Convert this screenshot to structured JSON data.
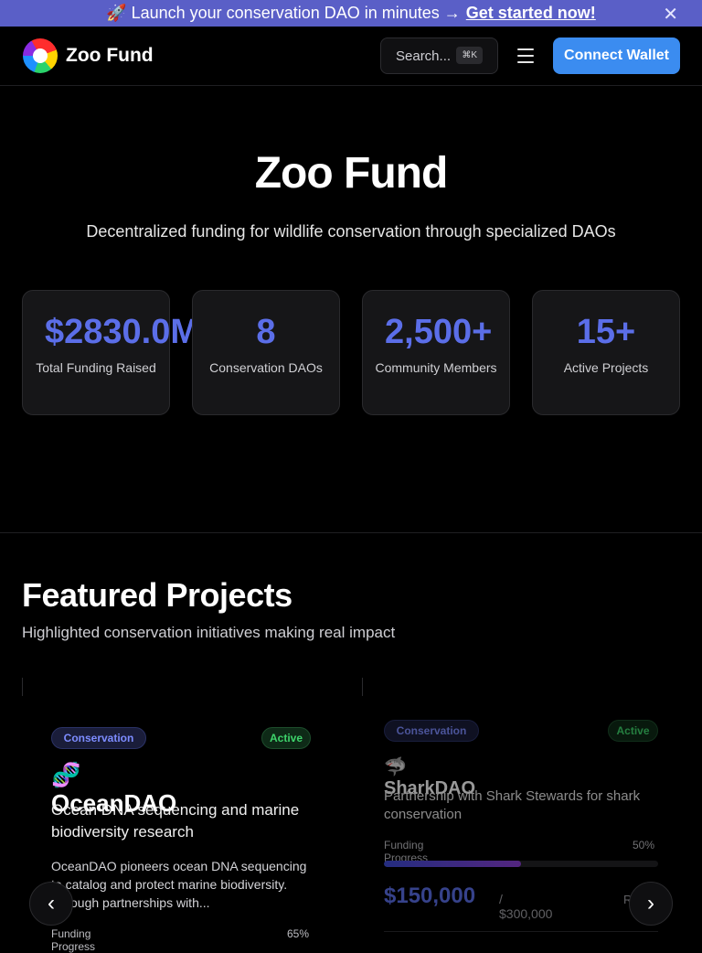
{
  "banner": {
    "text": "🚀 Launch your conservation DAO in minutes →",
    "link": "Get started now!",
    "close": "✕"
  },
  "nav": {
    "brand": "Zoo Fund",
    "search_placeholder": "Search...",
    "search_shortcut": "⌘K",
    "connect": "Connect Wallet"
  },
  "hero": {
    "title": "Zoo Fund",
    "subtitle": "Decentralized funding for wildlife conservation through specialized DAOs"
  },
  "stats": [
    {
      "value": "$2830.0M+",
      "label": "Total Funding Raised"
    },
    {
      "value": "8",
      "label": "Conservation DAOs"
    },
    {
      "value": "2,500+",
      "label": "Community Members"
    },
    {
      "value": "15+",
      "label": "Active Projects"
    }
  ],
  "featured": {
    "title": "Featured Projects",
    "subtitle": "Highlighted conservation initiatives making real impact",
    "projects": [
      {
        "category": "Conservation",
        "status": "Active",
        "icon": "🧬",
        "name": "OceanDAO",
        "tagline": "Ocean DNA sequencing and marine biodiversity research",
        "description": "OceanDAO pioneers ocean DNA sequencing to catalog and protect marine biodiversity. Through partnerships with...",
        "funding_label": "Funding Progress",
        "funding_pct": "65%"
      },
      {
        "category": "Conservation",
        "status": "Active",
        "icon": "🦈",
        "name": "SharkDAO",
        "tagline": "Partnership with Shark Stewards for shark conservation",
        "funding_label": "Funding Progress",
        "funding_pct": "50%",
        "progress": 0.5,
        "raised": "$150,000",
        "goal": "/ $300,000",
        "trailing": "R"
      }
    ]
  },
  "carousel": {
    "prev": "‹",
    "next": "›"
  }
}
